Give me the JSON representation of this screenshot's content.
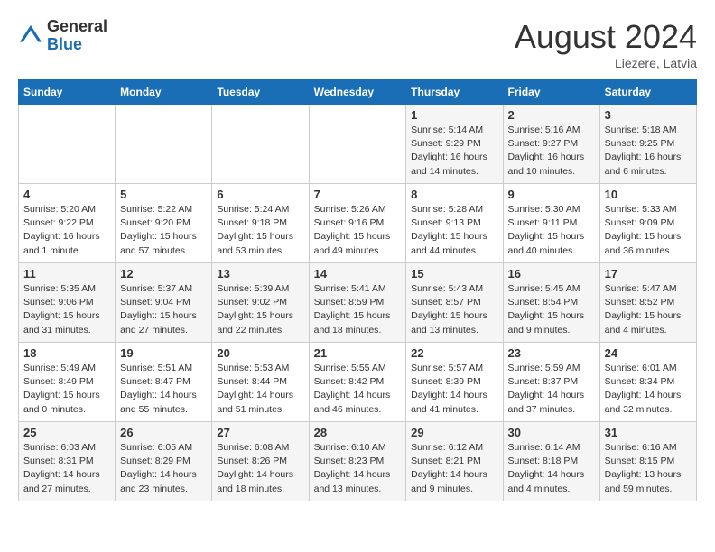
{
  "header": {
    "logo_general": "General",
    "logo_blue": "Blue",
    "month_year": "August 2024",
    "location": "Liezere, Latvia"
  },
  "weekdays": [
    "Sunday",
    "Monday",
    "Tuesday",
    "Wednesday",
    "Thursday",
    "Friday",
    "Saturday"
  ],
  "weeks": [
    [
      {
        "day": "",
        "info": ""
      },
      {
        "day": "",
        "info": ""
      },
      {
        "day": "",
        "info": ""
      },
      {
        "day": "",
        "info": ""
      },
      {
        "day": "1",
        "info": "Sunrise: 5:14 AM\nSunset: 9:29 PM\nDaylight: 16 hours\nand 14 minutes."
      },
      {
        "day": "2",
        "info": "Sunrise: 5:16 AM\nSunset: 9:27 PM\nDaylight: 16 hours\nand 10 minutes."
      },
      {
        "day": "3",
        "info": "Sunrise: 5:18 AM\nSunset: 9:25 PM\nDaylight: 16 hours\nand 6 minutes."
      }
    ],
    [
      {
        "day": "4",
        "info": "Sunrise: 5:20 AM\nSunset: 9:22 PM\nDaylight: 16 hours\nand 1 minute."
      },
      {
        "day": "5",
        "info": "Sunrise: 5:22 AM\nSunset: 9:20 PM\nDaylight: 15 hours\nand 57 minutes."
      },
      {
        "day": "6",
        "info": "Sunrise: 5:24 AM\nSunset: 9:18 PM\nDaylight: 15 hours\nand 53 minutes."
      },
      {
        "day": "7",
        "info": "Sunrise: 5:26 AM\nSunset: 9:16 PM\nDaylight: 15 hours\nand 49 minutes."
      },
      {
        "day": "8",
        "info": "Sunrise: 5:28 AM\nSunset: 9:13 PM\nDaylight: 15 hours\nand 44 minutes."
      },
      {
        "day": "9",
        "info": "Sunrise: 5:30 AM\nSunset: 9:11 PM\nDaylight: 15 hours\nand 40 minutes."
      },
      {
        "day": "10",
        "info": "Sunrise: 5:33 AM\nSunset: 9:09 PM\nDaylight: 15 hours\nand 36 minutes."
      }
    ],
    [
      {
        "day": "11",
        "info": "Sunrise: 5:35 AM\nSunset: 9:06 PM\nDaylight: 15 hours\nand 31 minutes."
      },
      {
        "day": "12",
        "info": "Sunrise: 5:37 AM\nSunset: 9:04 PM\nDaylight: 15 hours\nand 27 minutes."
      },
      {
        "day": "13",
        "info": "Sunrise: 5:39 AM\nSunset: 9:02 PM\nDaylight: 15 hours\nand 22 minutes."
      },
      {
        "day": "14",
        "info": "Sunrise: 5:41 AM\nSunset: 8:59 PM\nDaylight: 15 hours\nand 18 minutes."
      },
      {
        "day": "15",
        "info": "Sunrise: 5:43 AM\nSunset: 8:57 PM\nDaylight: 15 hours\nand 13 minutes."
      },
      {
        "day": "16",
        "info": "Sunrise: 5:45 AM\nSunset: 8:54 PM\nDaylight: 15 hours\nand 9 minutes."
      },
      {
        "day": "17",
        "info": "Sunrise: 5:47 AM\nSunset: 8:52 PM\nDaylight: 15 hours\nand 4 minutes."
      }
    ],
    [
      {
        "day": "18",
        "info": "Sunrise: 5:49 AM\nSunset: 8:49 PM\nDaylight: 15 hours\nand 0 minutes."
      },
      {
        "day": "19",
        "info": "Sunrise: 5:51 AM\nSunset: 8:47 PM\nDaylight: 14 hours\nand 55 minutes."
      },
      {
        "day": "20",
        "info": "Sunrise: 5:53 AM\nSunset: 8:44 PM\nDaylight: 14 hours\nand 51 minutes."
      },
      {
        "day": "21",
        "info": "Sunrise: 5:55 AM\nSunset: 8:42 PM\nDaylight: 14 hours\nand 46 minutes."
      },
      {
        "day": "22",
        "info": "Sunrise: 5:57 AM\nSunset: 8:39 PM\nDaylight: 14 hours\nand 41 minutes."
      },
      {
        "day": "23",
        "info": "Sunrise: 5:59 AM\nSunset: 8:37 PM\nDaylight: 14 hours\nand 37 minutes."
      },
      {
        "day": "24",
        "info": "Sunrise: 6:01 AM\nSunset: 8:34 PM\nDaylight: 14 hours\nand 32 minutes."
      }
    ],
    [
      {
        "day": "25",
        "info": "Sunrise: 6:03 AM\nSunset: 8:31 PM\nDaylight: 14 hours\nand 27 minutes."
      },
      {
        "day": "26",
        "info": "Sunrise: 6:05 AM\nSunset: 8:29 PM\nDaylight: 14 hours\nand 23 minutes."
      },
      {
        "day": "27",
        "info": "Sunrise: 6:08 AM\nSunset: 8:26 PM\nDaylight: 14 hours\nand 18 minutes."
      },
      {
        "day": "28",
        "info": "Sunrise: 6:10 AM\nSunset: 8:23 PM\nDaylight: 14 hours\nand 13 minutes."
      },
      {
        "day": "29",
        "info": "Sunrise: 6:12 AM\nSunset: 8:21 PM\nDaylight: 14 hours\nand 9 minutes."
      },
      {
        "day": "30",
        "info": "Sunrise: 6:14 AM\nSunset: 8:18 PM\nDaylight: 14 hours\nand 4 minutes."
      },
      {
        "day": "31",
        "info": "Sunrise: 6:16 AM\nSunset: 8:15 PM\nDaylight: 13 hours\nand 59 minutes."
      }
    ]
  ]
}
